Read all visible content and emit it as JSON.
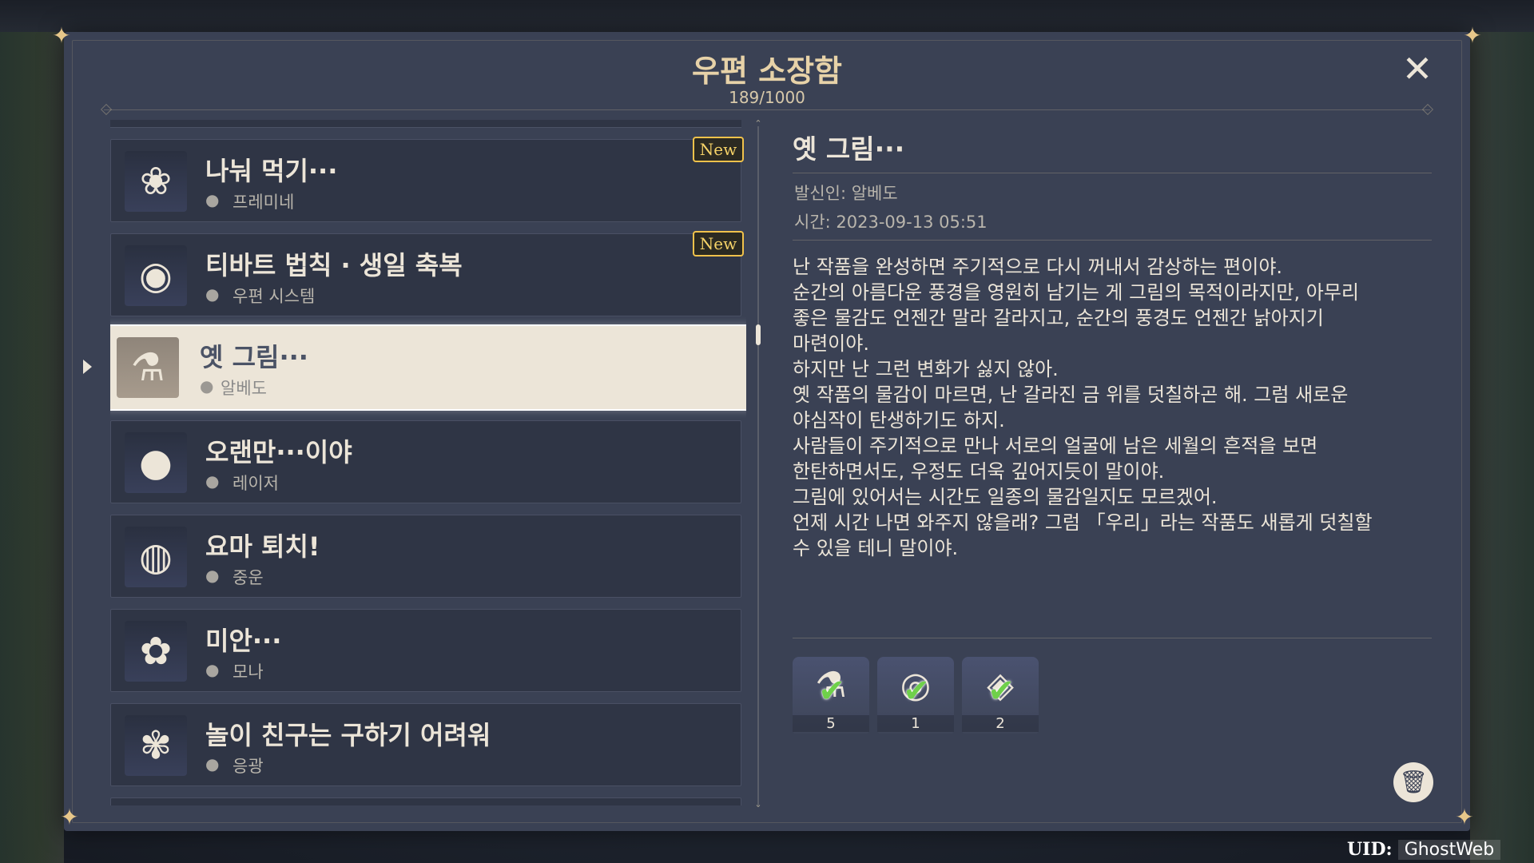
{
  "window": {
    "title": "우편 소장함",
    "count": "189/1000",
    "close_icon": "close-icon"
  },
  "mail_list": [
    {
      "title": "나눠 먹기···",
      "sender": "프레미네",
      "new": "New",
      "icon": "flower-icon"
    },
    {
      "title": "티바트 법칙 · 생일 축복",
      "sender": "우편 시스템",
      "new": "New",
      "icon": "cake-icon"
    },
    {
      "title": "옛 그림···",
      "sender": "알베도",
      "icon": "potion-icon",
      "selected": true
    },
    {
      "title": "오랜만···이야",
      "sender": "레이저",
      "icon": "berry-icon"
    },
    {
      "title": "요마 퇴치!",
      "sender": "중운",
      "icon": "orb-icon"
    },
    {
      "title": "미안···",
      "sender": "모나",
      "icon": "lotus-icon"
    },
    {
      "title": "놀이 친구는 구하기 어려워",
      "sender": "응광",
      "icon": "glaze-lily-icon"
    }
  ],
  "detail": {
    "title": "옛 그림···",
    "sender_line": "발신인: 알베도",
    "time_line": "시간: 2023-09-13 05:51",
    "body_lines": [
      "난 작품을 완성하면 주기적으로 다시 꺼내서 감상하는 편이야.",
      "순간의 아름다운 풍경을 영원히 남기는 게 그림의 목적이라지만, 아무리",
      "좋은 물감도 언젠간 말라 갈라지고, 순간의 풍경도 언젠간 낡아지기",
      "마련이야.",
      "하지만 난 그런 변화가 싫지 않아.",
      "옛 작품의 물감이 마르면, 난 갈라진 금 위를 덧칠하곤 해. 그럼 새로운",
      "야심작이 탄생하기도 하지.",
      "사람들이 주기적으로 만나 서로의 얼굴에 남은 세월의 흔적을 보면",
      "한탄하면서도, 우정도 더욱 깊어지듯이 말이야.",
      "그림에 있어서는 시간도 일종의 물감일지도 모르겠어.",
      "언제 시간 나면 와주지 않을래? 그럼 「우리」라는 작품도 새롭게 덧칠할",
      "수 있을 테니 말이야."
    ],
    "attachments": [
      {
        "icon": "potion-icon",
        "count": "5",
        "claimed": true
      },
      {
        "icon": "dish-icon",
        "count": "1",
        "claimed": true
      },
      {
        "icon": "crystal-bag-icon",
        "count": "2",
        "claimed": true
      }
    ]
  },
  "footer": {
    "uid_label": "UID:",
    "uid_value": "GhostWeb"
  },
  "colors": {
    "panel": "#3a4154",
    "item": "#2f3545",
    "selected": "#ece5d8",
    "badge": "#f1c24b",
    "title": "#e7d2a8"
  }
}
